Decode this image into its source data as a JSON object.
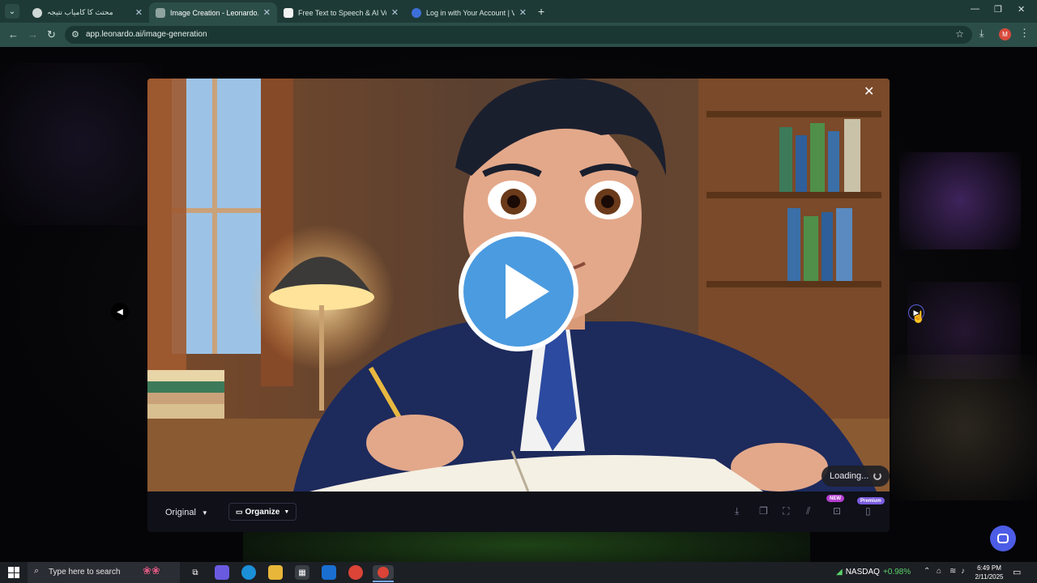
{
  "browser": {
    "tabs": [
      {
        "title": "محتث کا کامیاب نتیجہ",
        "icon": "globe-icon",
        "active": false
      },
      {
        "title": "Image Creation - Leonardo.Ai",
        "icon": "leonardo-icon",
        "active": true
      },
      {
        "title": "Free Text to Speech & AI Voice",
        "icon": "elevenlabs-icon",
        "active": false
      },
      {
        "title": "Log in with Your Account | Vid",
        "icon": "vidnoz-icon",
        "active": false
      }
    ],
    "new_tab": "+",
    "close_glyph": "✕",
    "url": "app.leonardo.ai/image-generation",
    "profile_initial": "M",
    "window_controls": {
      "minimize": "—",
      "maximize": "❐",
      "close": "✕"
    }
  },
  "modal": {
    "close": "✕",
    "loading_text": "Loading...",
    "original_label": "Original",
    "organize_label": "Organize",
    "badge_new": "NEW",
    "badge_premium": "Premium",
    "actions": [
      "download-icon",
      "copy-icon",
      "expand-icon",
      "magic-icon",
      "upscale-icon",
      "delete-icon"
    ]
  },
  "taskbar": {
    "search_placeholder": "Type here to search",
    "stock_name": "NASDAQ",
    "stock_change": "+0.98%",
    "time": "6:49 PM",
    "date": "2/11/2025"
  },
  "colors": {
    "browser_frame": "#1e3a36",
    "play_button": "#4b9be0",
    "accent": "#4d5ce6",
    "stock_up": "#5bd36a"
  }
}
